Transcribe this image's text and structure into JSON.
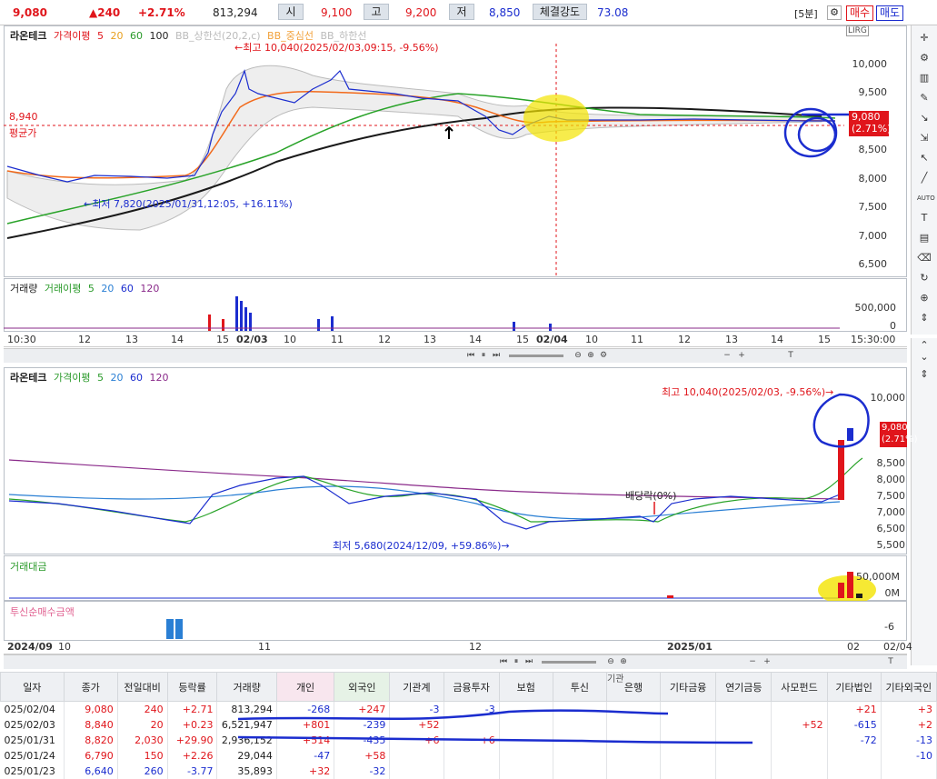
{
  "quote": {
    "price": "9,080",
    "change": "▲240",
    "pct": "+2.71%",
    "volume": "813,294",
    "open_label": "시",
    "open": "9,100",
    "high_label": "고",
    "high": "9,200",
    "low_label": "저",
    "low": "8,850",
    "strength_label": "체결강도",
    "strength": "73.08",
    "interval": "[5분]",
    "buy": "매수",
    "sell": "매도"
  },
  "chart1": {
    "legend": {
      "name": "라온테크",
      "ma_label": "가격이평",
      "ma": [
        "5",
        "20",
        "60",
        "100"
      ],
      "bb_upper": "BB_상한선(20,2,c)",
      "bb_mid": "BB_중심선",
      "bb_lower": "BB_하한선"
    },
    "high_note": "←최고 10,040(2025/02/03,09:15, -9.56%)",
    "low_note": "←최저 7,820(2025/01/31,12:05, +16.11%)",
    "avg_price": "8,940",
    "avg_label": "평균가",
    "price_tag": "9,080",
    "price_tag_pct": "(2.71%)",
    "yticks": [
      "10,000",
      "9,500",
      "9,000",
      "8,500",
      "8,000",
      "7,500",
      "7,000",
      "6,500"
    ],
    "panel_tags": "LIRG"
  },
  "volume1": {
    "legend": {
      "name": "거래량",
      "ma_label": "거래이평",
      "ma": [
        "5",
        "20",
        "60",
        "120"
      ]
    },
    "yticks": [
      "500,000",
      "0"
    ]
  },
  "xaxis1": [
    "10:30",
    "12",
    "13",
    "14",
    "15",
    "02/03",
    "10",
    "11",
    "12",
    "13",
    "14",
    "15",
    "02/04",
    "10",
    "11",
    "12",
    "13",
    "14",
    "15",
    "15:30:00"
  ],
  "chart2": {
    "legend": {
      "name": "라온테크",
      "ma_label": "가격이평",
      "ma": [
        "5",
        "20",
        "60",
        "120"
      ]
    },
    "high_note": "최고 10,040(2025/02/03, -9.56%)→",
    "low_note": "최저 5,680(2024/12/09, +59.86%)→",
    "dividend": "배당락(0%)",
    "price_tag": "9,080",
    "price_tag_pct": "(2.71%)",
    "yticks": [
      "10,000",
      "9,500",
      "9,000",
      "8,500",
      "8,000",
      "7,500",
      "7,000",
      "6,500",
      "6,000",
      "5,500"
    ]
  },
  "amount2": {
    "label": "거래대금",
    "yticks": [
      "50,000M",
      "0M"
    ]
  },
  "trust2": {
    "label": "투신순매수금액",
    "ytick": "-6"
  },
  "xaxis2": [
    "2024/09",
    "10",
    "11",
    "12",
    "2025/01",
    "02",
    "02/04"
  ],
  "table": {
    "headers": [
      "일자",
      "종가",
      "전일대비",
      "등락률",
      "거래량",
      "개인",
      "외국인",
      "기관계",
      "금융투자",
      "보험",
      "투신",
      "은행",
      "기타금융",
      "연기금등",
      "사모펀드",
      "기타법인",
      "기타외국인"
    ],
    "group_header": "기관",
    "rows": [
      [
        "025/02/04",
        "9,080",
        "240",
        "+2.71",
        "813,294",
        "-268",
        "+247",
        "-3",
        "-3",
        "",
        "",
        "",
        "",
        "",
        "",
        "+21",
        "+3"
      ],
      [
        "025/02/03",
        "8,840",
        "20",
        "+0.23",
        "6,521,947",
        "+801",
        "-239",
        "+52",
        "",
        "",
        "",
        "",
        "",
        "",
        "+52",
        "-615",
        "+2"
      ],
      [
        "025/01/31",
        "8,820",
        "2,030",
        "+29.90",
        "2,936,152",
        "+514",
        "-435",
        "+6",
        "+6",
        "",
        "",
        "",
        "",
        "",
        "",
        "-72",
        "-13"
      ],
      [
        "025/01/24",
        "6,790",
        "150",
        "+2.26",
        "29,044",
        "-47",
        "+58",
        "",
        "",
        "",
        "",
        "",
        "",
        "",
        "",
        "",
        "-10"
      ],
      [
        "025/01/23",
        "6,640",
        "260",
        "-3.77",
        "35,893",
        "+32",
        "-32",
        "",
        "",
        "",
        "",
        "",
        "",
        "",
        "",
        "",
        ""
      ]
    ],
    "row_colors": [
      "red",
      "red",
      "red",
      "red",
      "blue"
    ]
  },
  "colors": {
    "up": "#e0151b",
    "down": "#1b2dcf",
    "ma5": "#f26a1b",
    "ma20": "#29a329",
    "ma60": "#1a1a1a",
    "bb": "#bbbbbb"
  }
}
